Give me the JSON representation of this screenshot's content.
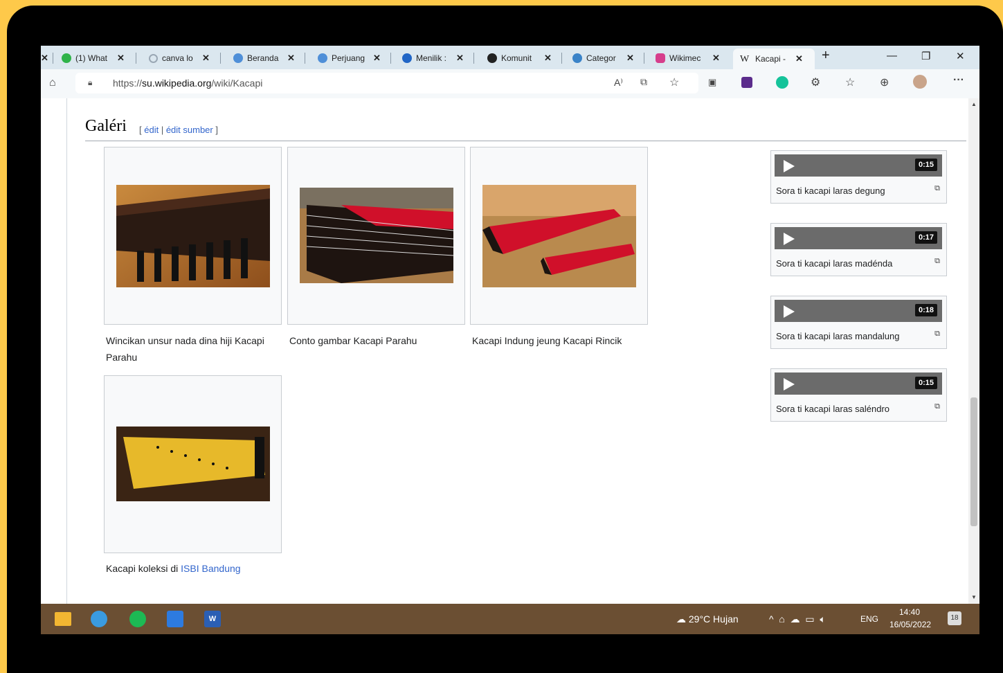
{
  "browser": {
    "tabs": [
      {
        "label": "(1) What",
        "color": "#2fb34a"
      },
      {
        "label": "canva lo",
        "color": "#9aa7b4"
      },
      {
        "label": "Beranda",
        "color": "#4f8fd8"
      },
      {
        "label": "Perjuang",
        "color": "#4f8fd8"
      },
      {
        "label": "Menilik :",
        "color": "#2166c6"
      },
      {
        "label": "Komunit",
        "color": "#222222"
      },
      {
        "label": "Categor",
        "color": "#3a83c8"
      },
      {
        "label": "Wikimec",
        "color": "#d63e8c"
      },
      {
        "label": "Kacapi -",
        "color": "#222222"
      }
    ],
    "tab_close": "✕",
    "new_tab": "+",
    "url_scheme": "https://",
    "url_host": "su.wikipedia.org",
    "url_path": "/wiki/Kacapi"
  },
  "section": {
    "title": "Galéri",
    "edit_open": "[ ",
    "edit_label": "édit",
    "edit_sep": " | ",
    "edit_source_label": "édit sumber",
    "edit_close": " ]"
  },
  "gallery": [
    {
      "caption": "Wincikan unsur nada dina hiji Kacapi Parahu"
    },
    {
      "caption": "Conto gambar Kacapi Parahu"
    },
    {
      "caption": "Kacapi Indung jeung Kacapi Rincik"
    },
    {
      "caption_prefix": "Kacapi koleksi di ",
      "caption_link": "ISBI Bandung"
    }
  ],
  "audio": [
    {
      "duration": "0:15",
      "caption": "Sora ti kacapi laras degung"
    },
    {
      "duration": "0:17",
      "caption": "Sora ti kacapi laras madénda"
    },
    {
      "duration": "0:18",
      "caption": "Sora ti kacapi laras mandalung"
    },
    {
      "duration": "0:15",
      "caption": "Sora ti kacapi laras saléndro"
    }
  ],
  "taskbar": {
    "weather": "29°C  Hujan",
    "lang": "ENG",
    "time": "14:40",
    "date": "16/05/2022",
    "notif_count": "18"
  }
}
